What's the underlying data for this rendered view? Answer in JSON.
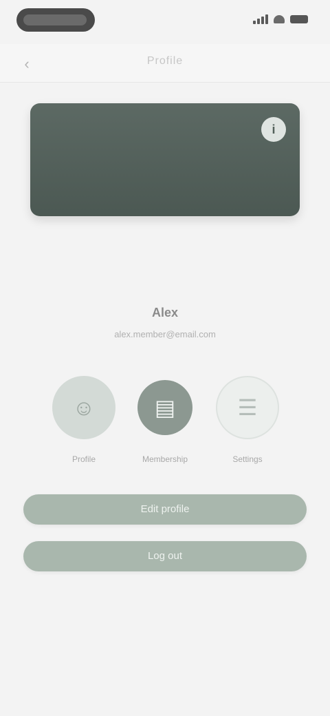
{
  "nav": {
    "back_icon": "‹",
    "title": "Profile"
  },
  "hero": {
    "badge_icon": "i",
    "caption": ""
  },
  "profile": {
    "name": "Alex",
    "subtitle": "alex.member@email.com"
  },
  "actions": [
    {
      "icon": "☺",
      "label": "Profile"
    },
    {
      "icon": "▤",
      "label": "Membership"
    },
    {
      "icon": "☰",
      "label": "Settings"
    }
  ],
  "buttons": {
    "primary": "Edit profile",
    "secondary": "Log out"
  },
  "colors": {
    "accent": "#52605a",
    "button": "#a9b7ad",
    "background": "#f3f3f3"
  }
}
